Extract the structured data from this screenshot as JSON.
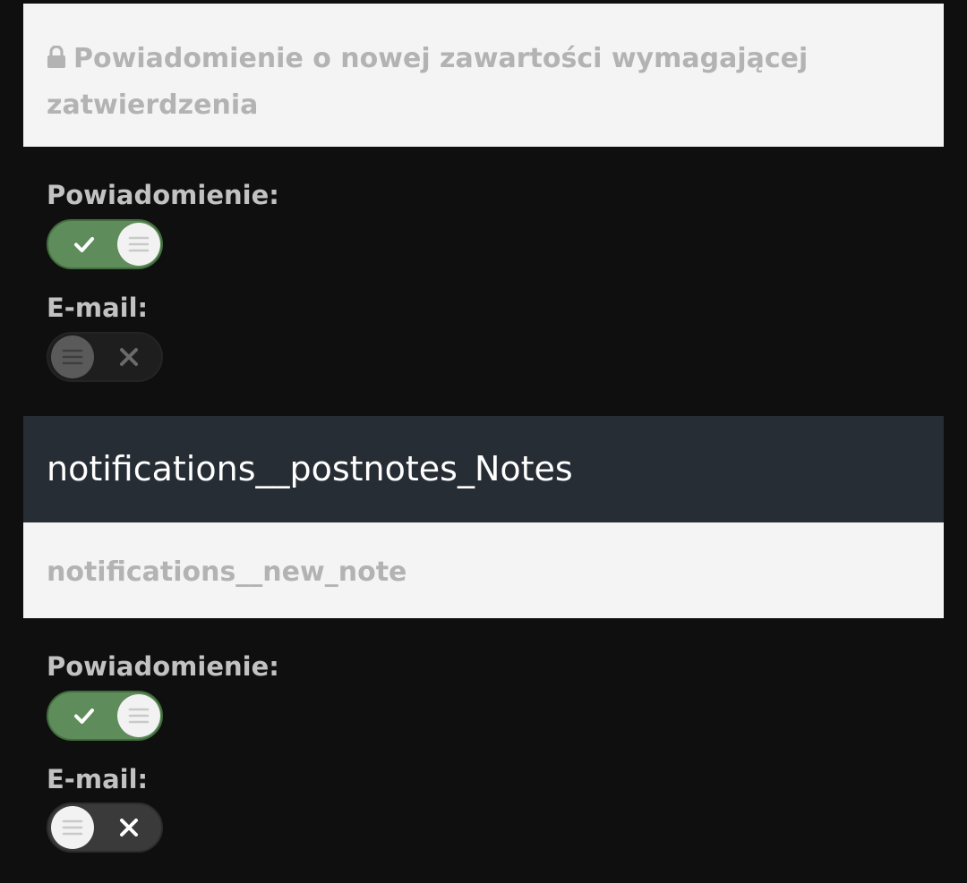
{
  "group1": {
    "header": "Powiadomienie o nowej zawartości wymagającej zatwierdzenia",
    "header_icon": "lock-icon",
    "notification_label": "Powiadomienie:",
    "notification_enabled": true,
    "email_label": "E-mail:",
    "email_enabled": false
  },
  "section": {
    "title": "notifications__postnotes_Notes"
  },
  "group2": {
    "header": "notifications__new_note",
    "notification_label": "Powiadomienie:",
    "notification_enabled": true,
    "email_label": "E-mail:",
    "email_enabled": false
  },
  "colors": {
    "toggle_on": "#5f8c5b",
    "section_bg": "#272d35",
    "page_bg": "#0f0f0f",
    "header_bg": "#f4f4f4"
  }
}
